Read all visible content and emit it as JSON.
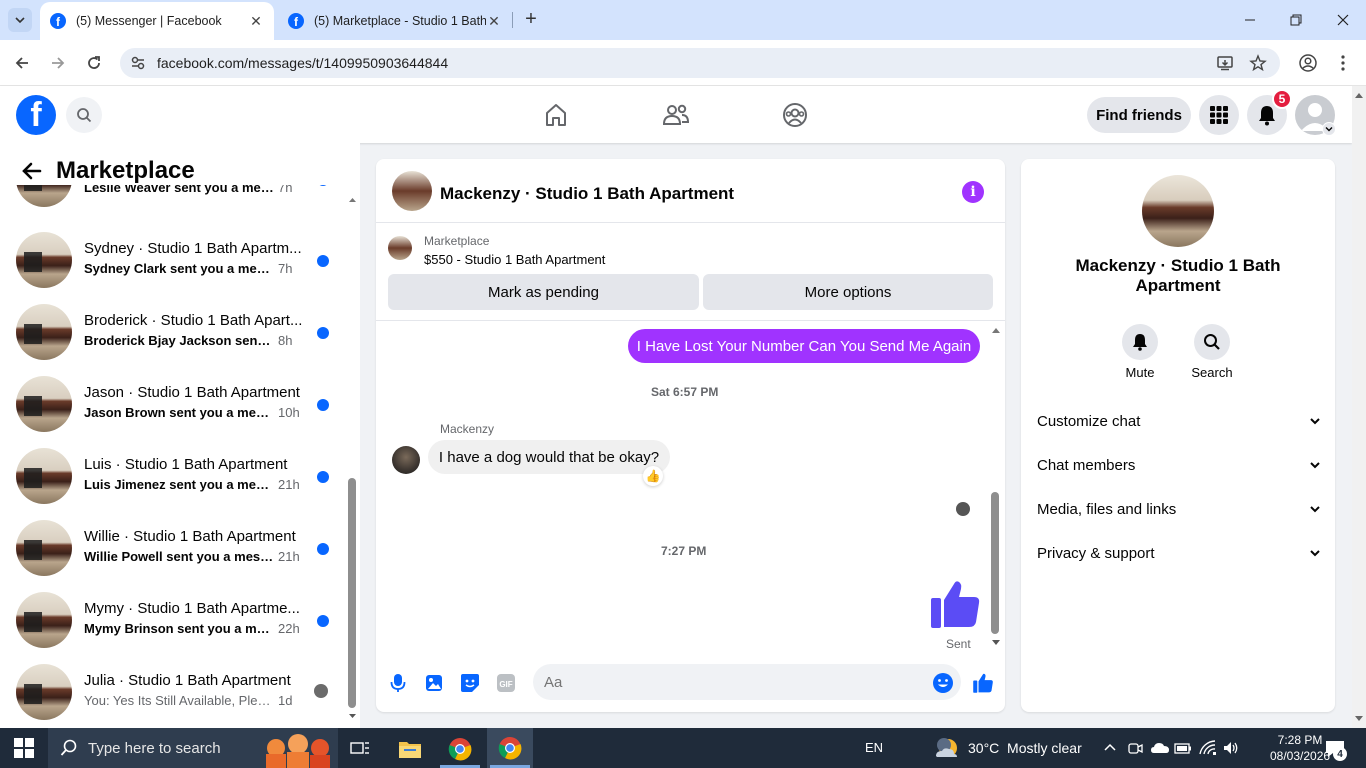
{
  "browser": {
    "tabs": [
      {
        "title": "(5) Messenger | Facebook",
        "active": true
      },
      {
        "title": "(5) Marketplace - Studio 1 Bath",
        "active": false
      }
    ],
    "url": "facebook.com/messages/t/1409950903644844"
  },
  "fb_nav": {
    "find_friends_label": "Find friends",
    "notification_count": "5"
  },
  "left_panel": {
    "title": "Marketplace",
    "conversations": [
      {
        "name": "",
        "snippet": "Leslie Weaver sent you a messa...",
        "time": "7h",
        "unread": true
      },
      {
        "name": "Sydney · Studio 1 Bath Apartm...",
        "snippet": "Sydney Clark sent you a messag...",
        "time": "7h",
        "unread": true
      },
      {
        "name": "Broderick · Studio 1 Bath Apart...",
        "snippet": "Broderick Bjay Jackson sent you...",
        "time": "8h",
        "unread": true
      },
      {
        "name": "Jason · Studio 1 Bath Apartment",
        "snippet": "Jason Brown sent you a messa...",
        "time": "10h",
        "unread": true
      },
      {
        "name": "Luis · Studio 1 Bath Apartment",
        "snippet": "Luis Jimenez sent you a messa...",
        "time": "21h",
        "unread": true
      },
      {
        "name": "Willie · Studio 1 Bath Apartment",
        "snippet": "Willie Powell sent you a messa...",
        "time": "21h",
        "unread": true
      },
      {
        "name": "Mymy · Studio 1 Bath Apartme...",
        "snippet": "Mymy Brinson sent you a mess...",
        "time": "22h",
        "unread": true
      },
      {
        "name": "Julia · Studio 1 Bath Apartment",
        "snippet": "You: Yes Its Still Available, Please...",
        "time": "1d",
        "unread": false
      }
    ]
  },
  "chat": {
    "title": "Mackenzy · Studio 1 Bath Apartment",
    "marketplace_label": "Marketplace",
    "listing": "$550 - Studio 1 Bath Apartment",
    "mark_pending_label": "Mark as pending",
    "more_options_label": "More options",
    "messages": {
      "outgoing_1": "I Have Lost Your Number Can You Send Me Again",
      "timestamp_1": "Sat 6:57 PM",
      "sender_name": "Mackenzy",
      "incoming_1": "I have a dog would that be okay?",
      "reaction": "👍",
      "timestamp_2": "7:27 PM",
      "status": "Sent"
    },
    "composer_placeholder": "Aa"
  },
  "info_panel": {
    "name": "Mackenzy · Studio 1 Bath Apartment",
    "mute_label": "Mute",
    "search_label": "Search",
    "sections": [
      "Customize chat",
      "Chat members",
      "Media, files and links",
      "Privacy & support"
    ]
  },
  "taskbar": {
    "search_placeholder": "Type here to search",
    "language": "EN",
    "weather": "30°C  Mostly clear",
    "time": "7:28 PM",
    "date": "08/03/2026",
    "notification_count": "4"
  },
  "colors": {
    "fb_blue": "#0866ff",
    "messenger_purple": "#a033ff",
    "unread_dot": "#0866ff"
  }
}
